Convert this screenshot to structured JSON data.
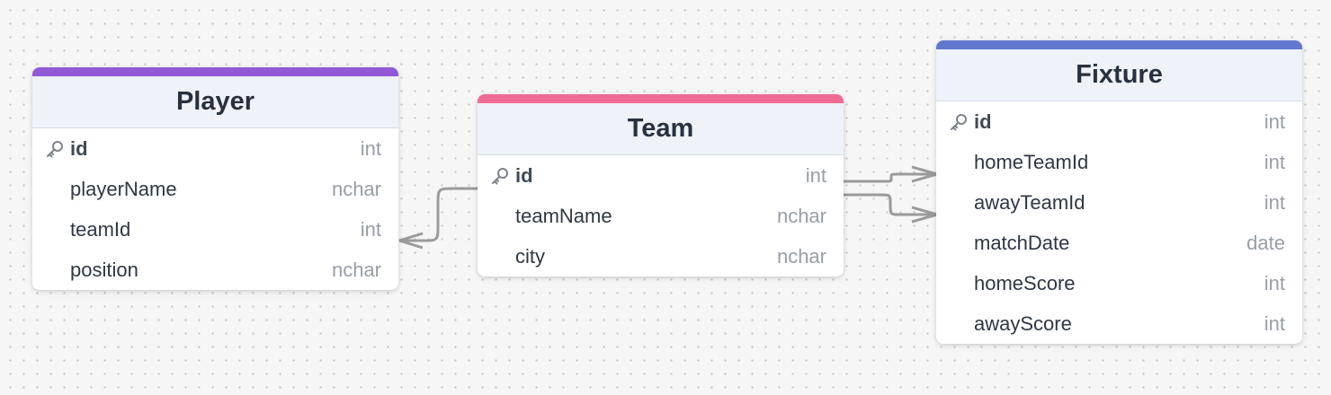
{
  "tables": {
    "player": {
      "title": "Player",
      "accent": "#9159d6",
      "columns": [
        {
          "name": "id",
          "type": "int",
          "primary_key": true
        },
        {
          "name": "playerName",
          "type": "nchar"
        },
        {
          "name": "teamId",
          "type": "int"
        },
        {
          "name": "position",
          "type": "nchar"
        }
      ]
    },
    "team": {
      "title": "Team",
      "accent": "#f06b94",
      "columns": [
        {
          "name": "id",
          "type": "int",
          "primary_key": true
        },
        {
          "name": "teamName",
          "type": "nchar"
        },
        {
          "name": "city",
          "type": "nchar"
        }
      ]
    },
    "fixture": {
      "title": "Fixture",
      "accent": "#6477cf",
      "columns": [
        {
          "name": "id",
          "type": "int",
          "primary_key": true
        },
        {
          "name": "homeTeamId",
          "type": "int"
        },
        {
          "name": "awayTeamId",
          "type": "int"
        },
        {
          "name": "matchDate",
          "type": "date"
        },
        {
          "name": "homeScore",
          "type": "int"
        },
        {
          "name": "awayScore",
          "type": "int"
        }
      ]
    }
  },
  "relationships": [
    {
      "from": "player.teamId",
      "to": "team.id",
      "cardinality": "many-to-one"
    },
    {
      "from": "fixture.homeTeamId",
      "to": "team.id",
      "cardinality": "many-to-one"
    },
    {
      "from": "fixture.awayTeamId",
      "to": "team.id",
      "cardinality": "many-to-one"
    }
  ],
  "icons": {
    "primary_key": "key-icon"
  },
  "colors": {
    "connector": "#9a9a9a",
    "background": "#f6f6f6"
  }
}
